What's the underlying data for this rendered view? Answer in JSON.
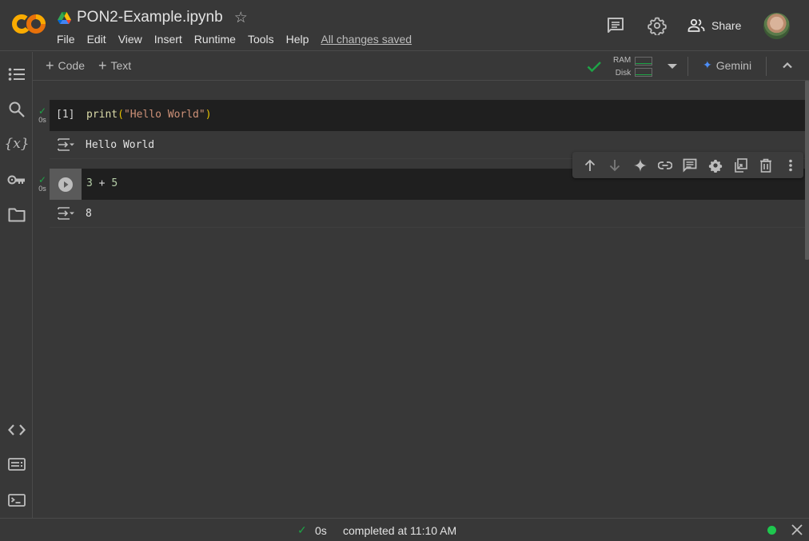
{
  "header": {
    "notebook_title": "PON2-Example.ipynb",
    "menu": [
      "File",
      "Edit",
      "View",
      "Insert",
      "Runtime",
      "Tools",
      "Help"
    ],
    "save_status": "All changes saved",
    "share_label": "Share",
    "icons": {
      "logo": "colab-logo",
      "drive": "google-drive-icon",
      "star": "star-outline-icon",
      "comments": "comment-icon",
      "settings": "gear-icon",
      "share": "people-icon",
      "avatar": "user-avatar"
    }
  },
  "sidebar": {
    "top_items": [
      {
        "name": "table-of-contents",
        "icon": "list-icon"
      },
      {
        "name": "find-and-replace",
        "icon": "search-icon"
      },
      {
        "name": "variables",
        "icon": "variables-icon",
        "glyph": "{x}"
      },
      {
        "name": "secrets",
        "icon": "key-icon"
      },
      {
        "name": "files",
        "icon": "folder-icon"
      }
    ],
    "bottom_items": [
      {
        "name": "code-snippets",
        "icon": "code-icon"
      },
      {
        "name": "command-palette",
        "icon": "keyboard-icon"
      },
      {
        "name": "terminal",
        "icon": "terminal-icon"
      }
    ]
  },
  "toolbar": {
    "add_code_label": "Code",
    "add_text_label": "Text",
    "ram_label": "RAM",
    "disk_label": "Disk",
    "gemini_label": "Gemini",
    "runtime_connected": true,
    "ram_usage_fraction": 0.0,
    "disk_usage_fraction": 0.0
  },
  "cells": [
    {
      "type": "code",
      "execution_count": "[1]",
      "exec_time": "0s",
      "status": "success",
      "source_tokens": [
        {
          "t": "print",
          "k": "fn"
        },
        {
          "t": "(",
          "k": "paren"
        },
        {
          "t": "\"Hello World\"",
          "k": "str"
        },
        {
          "t": ")",
          "k": "paren"
        }
      ],
      "output": "Hello World"
    },
    {
      "type": "code",
      "execution_count": "",
      "exec_time": "0s",
      "status": "success",
      "source_tokens": [
        {
          "t": "3",
          "k": "num"
        },
        {
          "t": " + ",
          "k": "op"
        },
        {
          "t": "5",
          "k": "num"
        }
      ],
      "output": "8"
    }
  ],
  "cell_toolbar": [
    {
      "name": "move-cell-up",
      "icon": "arrow-up-icon"
    },
    {
      "name": "move-cell-down",
      "icon": "arrow-down-icon"
    },
    {
      "name": "gemini-cell",
      "icon": "sparkle-icon"
    },
    {
      "name": "link-to-cell",
      "icon": "link-icon"
    },
    {
      "name": "add-comment",
      "icon": "comment-icon"
    },
    {
      "name": "cell-settings",
      "icon": "gear-icon"
    },
    {
      "name": "mirror-cell",
      "icon": "mirror-cell-icon"
    },
    {
      "name": "delete-cell",
      "icon": "trash-icon"
    },
    {
      "name": "more-actions",
      "icon": "more-vert-icon"
    }
  ],
  "statusbar": {
    "exec_time": "0s",
    "message": "completed at 11:10 AM",
    "status_color": "#1ec74e"
  },
  "colors": {
    "accent_success": "#1ea446",
    "gemini_blue": "#4d8ef7",
    "logo_orange": "#f9ab00",
    "logo_orange_dark": "#e8710a"
  }
}
